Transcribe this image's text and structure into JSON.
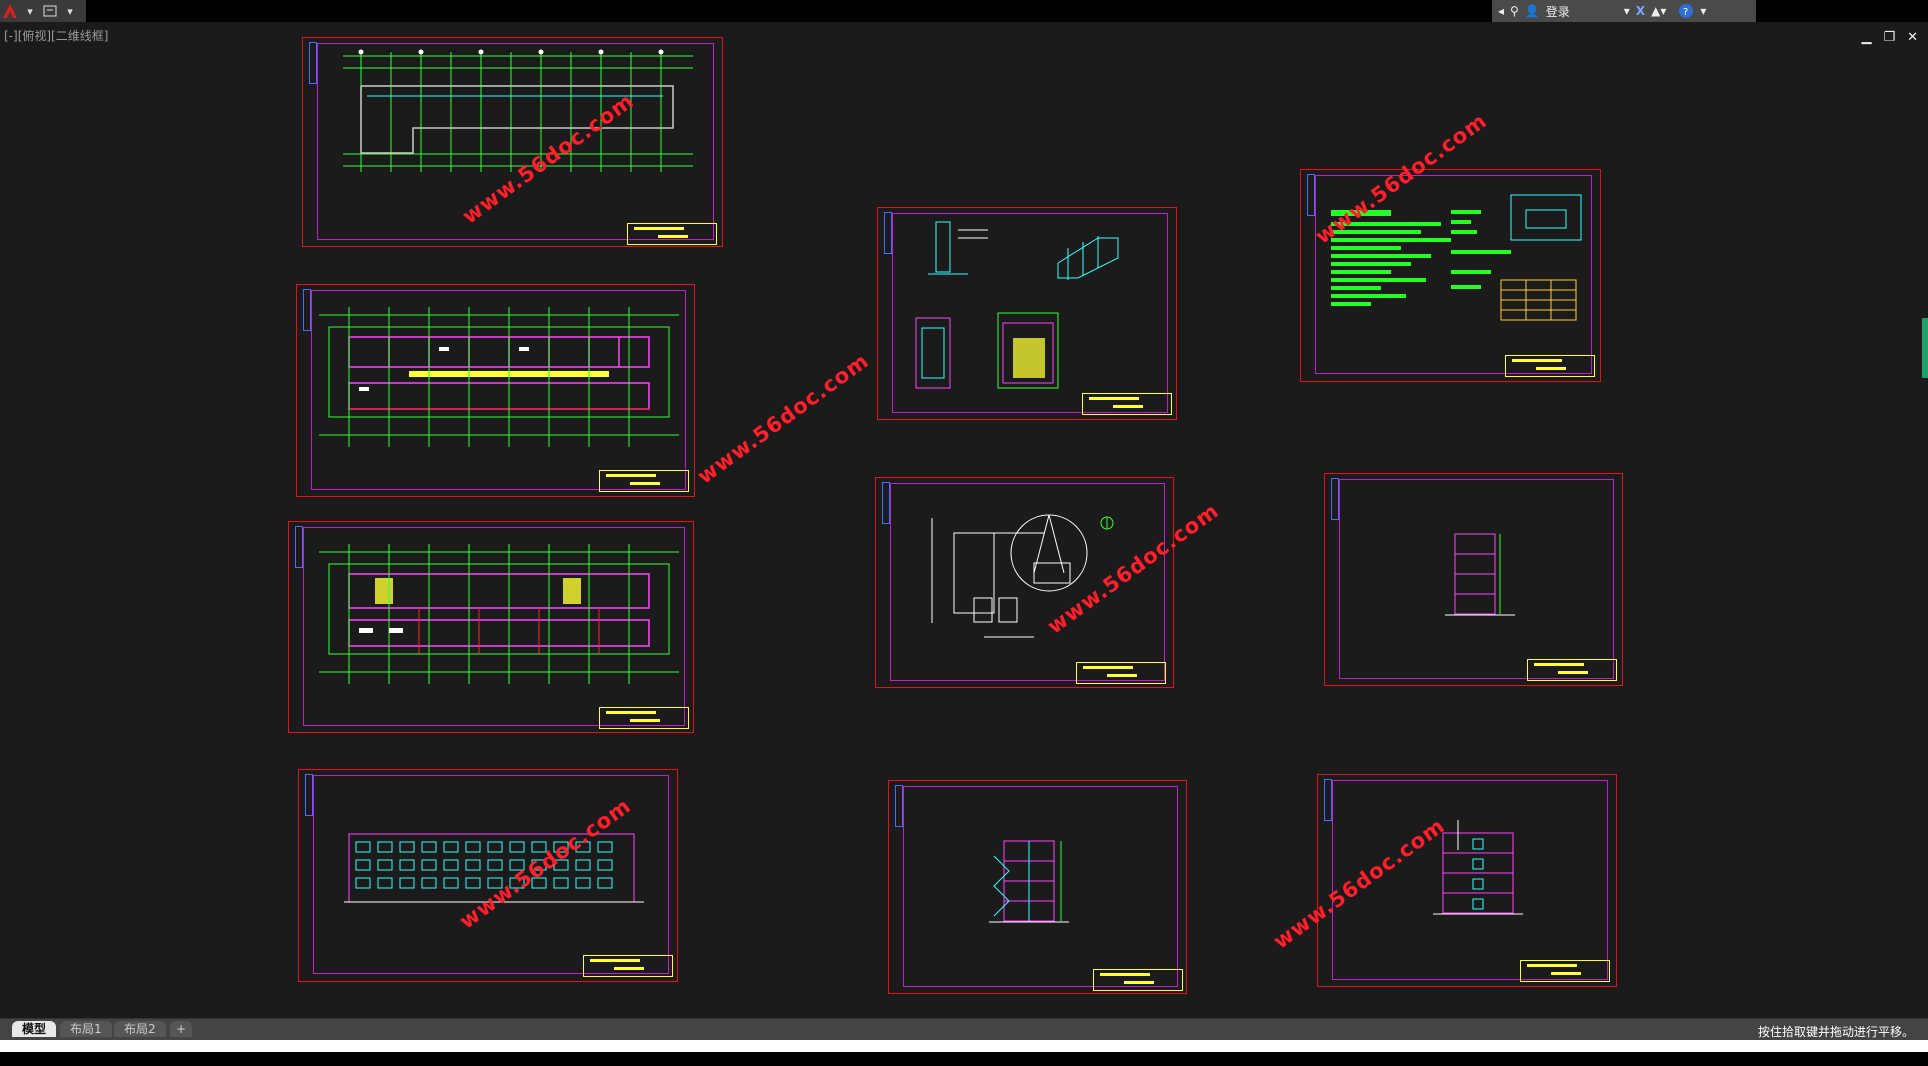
{
  "app": {
    "view_label": "[-][俯视][二维线框]",
    "login_label": "登录",
    "status_text": "按住拾取键并拖动进行平移。"
  },
  "tabs": [
    {
      "label": "模型",
      "active": true
    },
    {
      "label": "布局1",
      "active": false
    },
    {
      "label": "布局2",
      "active": false
    },
    {
      "label": "+",
      "active": false
    }
  ],
  "watermark_text": "www.56doc.com",
  "sheets": [
    {
      "name": "sheet-foundation-plan",
      "kind": "plan-outline"
    },
    {
      "name": "sheet-floor-plan-1",
      "kind": "floor-plan"
    },
    {
      "name": "sheet-floor-plan-2",
      "kind": "floor-plan"
    },
    {
      "name": "sheet-front-elevation",
      "kind": "elevation"
    },
    {
      "name": "sheet-details",
      "kind": "details"
    },
    {
      "name": "sheet-site-plan",
      "kind": "site"
    },
    {
      "name": "sheet-stair-section",
      "kind": "section"
    },
    {
      "name": "sheet-notes",
      "kind": "notes"
    },
    {
      "name": "sheet-side-elevation",
      "kind": "section-small"
    },
    {
      "name": "sheet-end-elevation",
      "kind": "end-elevation"
    }
  ],
  "colors": {
    "frame": "#e0141c",
    "inner": "#c020c8",
    "axis": "#33ff33",
    "wall": "#ff44ff",
    "text": "#ffff33",
    "cyan": "#33ffff",
    "watermark": "#ff1e2a"
  }
}
